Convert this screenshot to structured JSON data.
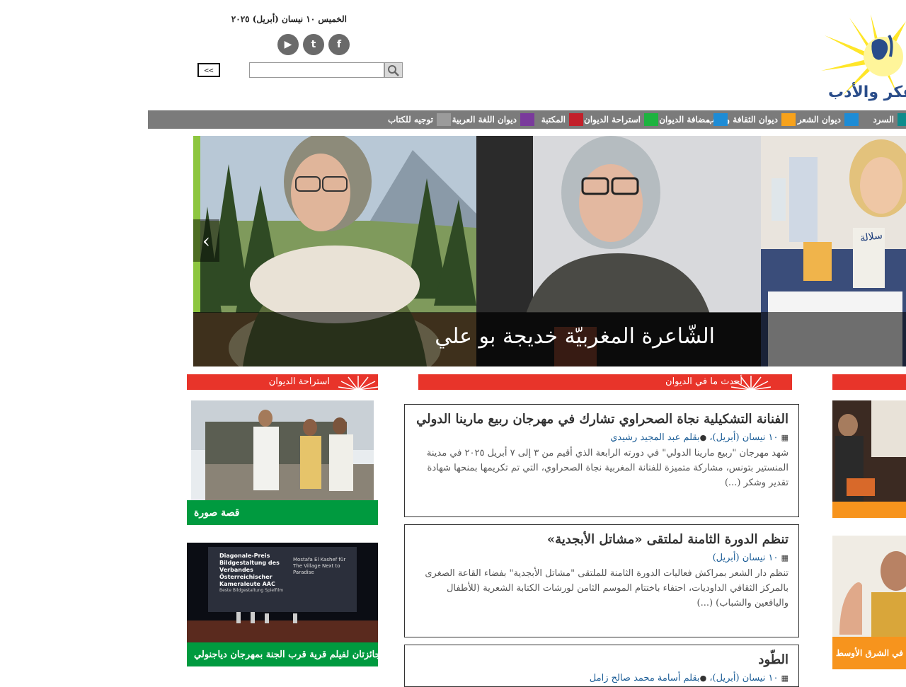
{
  "header": {
    "date": "الخميس ١٠ نيسان (أبريل) ٢٠٢٥",
    "social": [
      {
        "name": "facebook-icon",
        "glyph": "f"
      },
      {
        "name": "twitter-icon",
        "glyph": "t"
      },
      {
        "name": "youtube-icon",
        "glyph": "▶"
      }
    ],
    "back_label": "<<",
    "search_placeholder": "",
    "logo_text": "الفكر والأدب"
  },
  "nav": {
    "items": [
      {
        "label": "السرد",
        "color": "#0e8c8c"
      },
      {
        "label": "ديوان الشعر",
        "color": "#f7a21b"
      },
      {
        "label": "ديوان الثقافة والأدب",
        "color": "#1d8cd6"
      },
      {
        "label": "مضافة الديوان",
        "color": "#1db33f"
      },
      {
        "label": "استراحة الديوان",
        "color": "#c3202a"
      },
      {
        "label": "المكتبة",
        "color": "#7a3a9c"
      },
      {
        "label": "ديوان اللغة العربية",
        "color": "#9b9b9b"
      },
      {
        "label": "توجيه للكتاب",
        "color": ""
      }
    ]
  },
  "hero": {
    "title": "الشّاعرة المغربيّة خديجة بو علي",
    "prev_label": "‹"
  },
  "sections": {
    "left_header": "استراحة الديوان",
    "middle_header": "أحدث ما في الديوان"
  },
  "left_cards": [
    {
      "caption": "قصة صورة"
    },
    {
      "caption": "جائزتان لفيلم قرية قرب الجنة بمهرجان دياجنولي"
    }
  ],
  "articles": [
    {
      "title": "الفنانة التشكيلية نجاة الصحراوي تشارك في مهرجان ربيع مارينا الدولي",
      "date": "١٠ نيسان (أبريل)،",
      "author": "بقلم عبد المجيد رشيدي",
      "body": "شهد مهرجان \"ربيع مارينا الدولي\" في دورته الرابعة الذي أقيم من ٣ إلى ٧ أبريل ٢٠٢٥ في مدينة المنستير بتونس، مشاركة متميزة للفنانة المغربية نجاة الصحراوي، التي تم تكريمها بمنحها شهادة تقدير وشكر (...)"
    },
    {
      "title": "تنظم الدورة الثامنة لملتقى «مشاتل الأبجدية»",
      "date": "١٠ نيسان (أبريل)",
      "author": "",
      "body": "تنظم دار الشعر بمراكش فعاليات الدورة الثامنة للملتقى \"مشاتل الأبجدية\" بفضاء القاعة الصغرى بالمركز الثقافي الداوديات، احتفاء باختتام الموسم الثامن لورشات الكتابة الشعرية (للأطفال واليافعين والشباب) (...)"
    },
    {
      "title": "الطّود",
      "date": "١٠ نيسان (أبريل)،",
      "author": "بقلم أسامة محمد صالح زامل",
      "body": ""
    }
  ],
  "right_strip": {
    "caption": "في الشرق الأوسط"
  },
  "screen_text": {
    "poster_title": "Diagonale-Preis Bildgestaltung des Verbandes Österreichischer Kameraleute AAC",
    "poster_sub": "Beste Bildgestaltung Spielfilm",
    "poster_right": "Mostafa El Kashef für The Village Next to Paradise",
    "book_title": "سلالة"
  }
}
